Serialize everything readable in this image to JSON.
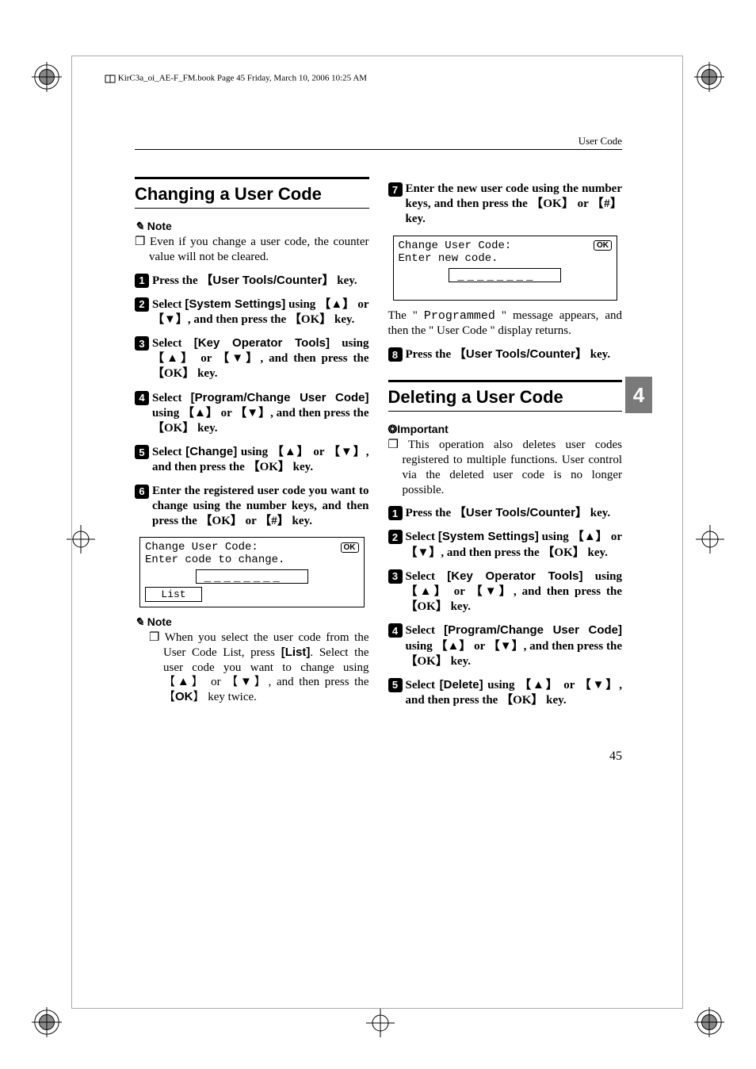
{
  "meta_line": "KirC3a_oi_AE-F_FM.book  Page 45  Friday, March 10, 2006  10:25 AM",
  "header": "User Code",
  "page_number": "45",
  "side_tab": "4",
  "left": {
    "h1": "Changing a User Code",
    "note_label": "Note",
    "note_items": [
      "❒ Even if you change a user code, the counter value will not be cleared."
    ],
    "steps": [
      {
        "n": "1",
        "pre": "Press the ",
        "key1": "User Tools/Counter",
        "post": " key."
      },
      {
        "n": "2",
        "pre": "Select ",
        "menu": "[System Settings]",
        "mid": " using ",
        "keysline": "【▲】 or 【▼】, and then press the 【OK】 key."
      },
      {
        "n": "3",
        "pre": "Select ",
        "menu": "[Key Operator Tools]",
        "mid": " using ",
        "keysline": "【▲】 or 【▼】, and then press the 【OK】 key."
      },
      {
        "n": "4",
        "pre": "Select ",
        "menu": "[Program/Change User Code]",
        "mid": " using ",
        "keysline": "【▲】 or 【▼】, and then press the 【OK】 key."
      },
      {
        "n": "5",
        "pre": "Select ",
        "menu": "[Change]",
        "mid": " using ",
        "keysline": "【▲】 or 【▼】, and then press the 【OK】 key."
      },
      {
        "n": "6",
        "full": "Enter the registered user code you want to change using the number keys, and then press the 【OK】 or 【#】 key."
      }
    ],
    "lcd1": {
      "title": "Change User Code:",
      "ok": "OK",
      "line2": "Enter code to change.",
      "list": "List"
    },
    "note2_label": "Note",
    "note2_text": "❒ When you select the user code from the User Code List, press [List]. Select the user code you want to change using 【▲】 or 【▼】, and then press the 【OK】 key twice.",
    "list_menu": "[List]"
  },
  "right": {
    "steps_top": [
      {
        "n": "7",
        "full": "Enter the new user code using the number keys, and then press the 【OK】 or 【#】 key."
      }
    ],
    "lcd2": {
      "title": "Change User Code:",
      "ok": "OK",
      "line2": "Enter new code."
    },
    "result_text_pre": "The \" ",
    "result_mono": "Programmed",
    "result_text_post": " \" message appears, and then the \" User Code \" display returns.",
    "step8": {
      "n": "8",
      "pre": "Press the ",
      "key1": "User Tools/Counter",
      "post": " key."
    },
    "h2": "Deleting a User Code",
    "important_label": "Important",
    "important_text": "❒ This operation also deletes user codes registered to multiple functions. User control via the deleted user code is no longer possible.",
    "steps2": [
      {
        "n": "1",
        "pre": "Press the ",
        "key1": "User Tools/Counter",
        "post": " key."
      },
      {
        "n": "2",
        "pre": "Select ",
        "menu": "[System Settings]",
        "mid": " using ",
        "keysline": "【▲】 or 【▼】, and then press the 【OK】 key."
      },
      {
        "n": "3",
        "pre": "Select ",
        "menu": "[Key Operator Tools]",
        "mid": " using ",
        "keysline": "【▲】 or 【▼】, and then press the 【OK】 key."
      },
      {
        "n": "4",
        "pre": "Select ",
        "menu": "[Program/Change User Code]",
        "mid": " using ",
        "keysline": "【▲】 or 【▼】, and then press the 【OK】 key."
      },
      {
        "n": "5",
        "pre": "Select ",
        "menu": "[Delete]",
        "mid": " using ",
        "keysline": "【▲】 or 【▼】, and then press the 【OK】 key."
      }
    ]
  }
}
